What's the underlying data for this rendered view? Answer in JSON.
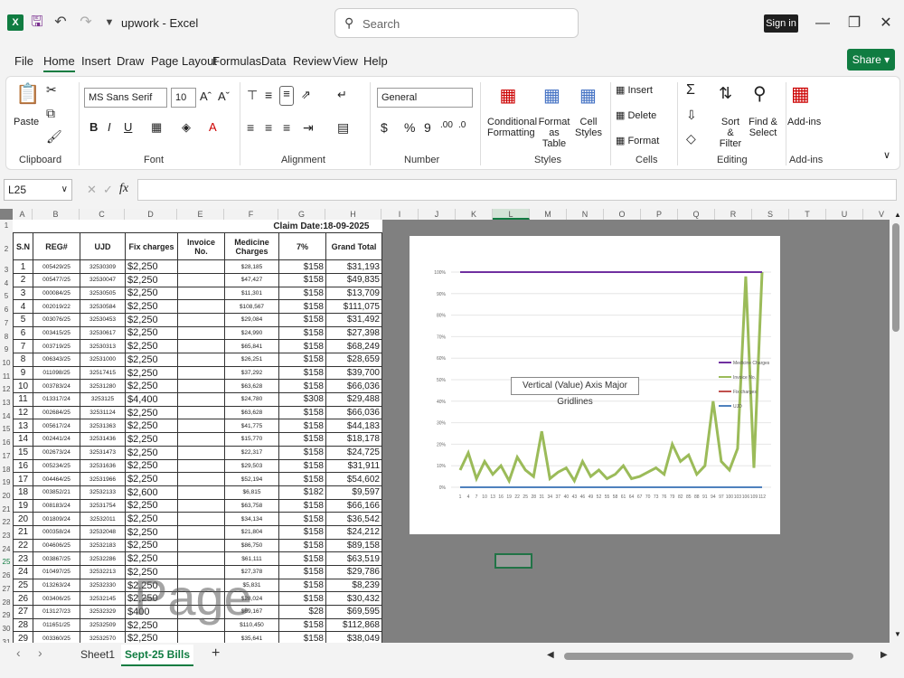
{
  "app": {
    "file_name": "upwork",
    "app_name": "Excel",
    "sign_in": "Sign in",
    "search_placeholder": "Search"
  },
  "menu": [
    "File",
    "Home",
    "Insert",
    "Draw",
    "Page Layout",
    "Formulas",
    "Data",
    "Review",
    "View",
    "Help"
  ],
  "share_label": "Share",
  "ribbon": {
    "clipboard": {
      "paste": "Paste",
      "label": "Clipboard"
    },
    "font": {
      "name": "MS Sans Serif",
      "size": "10",
      "label": "Font"
    },
    "alignment": {
      "label": "Alignment"
    },
    "number": {
      "format": "General",
      "label": "Number"
    },
    "styles": {
      "conditional": "Conditional",
      "formatting": "Formatting",
      "format_as": "Format as",
      "table": "Table",
      "cell": "Cell",
      "styles_text": "Styles",
      "label": "Styles"
    },
    "cells": {
      "insert": "Insert",
      "delete": "Delete",
      "format": "Format",
      "label": "Cells"
    },
    "editing": {
      "sort": "Sort &",
      "filter": "Filter",
      "find": "Find &",
      "select": "Select",
      "label": "Editing"
    },
    "addins": {
      "button": "Add-ins",
      "label": "Add-ins"
    }
  },
  "formula_bar": {
    "cell_ref": "L25",
    "fx": "fx"
  },
  "columns": [
    "A",
    "B",
    "C",
    "D",
    "E",
    "F",
    "G",
    "H",
    "I",
    "J",
    "K",
    "L",
    "M",
    "N",
    "O",
    "P",
    "Q",
    "R",
    "S",
    "T",
    "U",
    "V"
  ],
  "sheet": {
    "claim_date": "Claim Date:18-09-2025",
    "headers": [
      "S.N",
      "REG#",
      "UJD",
      "Fix charges",
      "Invoice No.",
      "Medicine Charges",
      "7%",
      "Grand Total"
    ],
    "rows": [
      [
        "1",
        "005429/25",
        "32530309",
        "$2,250",
        "",
        "$28,185",
        "$158",
        "$31,193"
      ],
      [
        "2",
        "005477/25",
        "32530047",
        "$2,250",
        "",
        "$47,427",
        "$158",
        "$49,835"
      ],
      [
        "3",
        "000084/25",
        "32530505",
        "$2,250",
        "",
        "$11,301",
        "$158",
        "$13,709"
      ],
      [
        "4",
        "002019/22",
        "32530584",
        "$2,250",
        "",
        "$108,567",
        "$158",
        "$111,075"
      ],
      [
        "5",
        "003076/25",
        "32530453",
        "$2,250",
        "",
        "$29,084",
        "$158",
        "$31,492"
      ],
      [
        "6",
        "003415/25",
        "32530617",
        "$2,250",
        "",
        "$24,990",
        "$158",
        "$27,398"
      ],
      [
        "7",
        "003719/25",
        "32530313",
        "$2,250",
        "",
        "$65,841",
        "$158",
        "$68,249"
      ],
      [
        "8",
        "006343/25",
        "32531000",
        "$2,250",
        "",
        "$26,251",
        "$158",
        "$28,659"
      ],
      [
        "9",
        "011098/25",
        "32517415",
        "$2,250",
        "",
        "$37,292",
        "$158",
        "$39,700"
      ],
      [
        "10",
        "003783/24",
        "32531280",
        "$2,250",
        "",
        "$63,628",
        "$158",
        "$66,036"
      ],
      [
        "11",
        "013317/24",
        "3253125",
        "$4,400",
        "",
        "$24,780",
        "$308",
        "$29,488"
      ],
      [
        "12",
        "002684/25",
        "32531124",
        "$2,250",
        "",
        "$63,628",
        "$158",
        "$66,036"
      ],
      [
        "13",
        "005617/24",
        "32531363",
        "$2,250",
        "",
        "$41,775",
        "$158",
        "$44,183"
      ],
      [
        "14",
        "002441/24",
        "32531436",
        "$2,250",
        "",
        "$15,770",
        "$158",
        "$18,178"
      ],
      [
        "15",
        "002673/24",
        "32531473",
        "$2,250",
        "",
        "$22,317",
        "$158",
        "$24,725"
      ],
      [
        "16",
        "005234/25",
        "32531636",
        "$2,250",
        "",
        "$29,503",
        "$158",
        "$31,911"
      ],
      [
        "17",
        "004464/25",
        "32531966",
        "$2,250",
        "",
        "$52,194",
        "$158",
        "$54,602"
      ],
      [
        "18",
        "003852/21",
        "32532133",
        "$2,600",
        "",
        "$6,815",
        "$182",
        "$9,597"
      ],
      [
        "19",
        "008183/24",
        "32531754",
        "$2,250",
        "",
        "$63,758",
        "$158",
        "$66,166"
      ],
      [
        "20",
        "001809/24",
        "32532011",
        "$2,250",
        "",
        "$34,134",
        "$158",
        "$36,542"
      ],
      [
        "21",
        "000358/24",
        "32532048",
        "$2,250",
        "",
        "$21,804",
        "$158",
        "$24,212"
      ],
      [
        "22",
        "004606/25",
        "32532183",
        "$2,250",
        "",
        "$86,750",
        "$158",
        "$89,158"
      ],
      [
        "23",
        "003867/25",
        "32532286",
        "$2,250",
        "",
        "$61,111",
        "$158",
        "$63,519"
      ],
      [
        "24",
        "010497/25",
        "32532213",
        "$2,250",
        "",
        "$27,378",
        "$158",
        "$29,786"
      ],
      [
        "25",
        "013263/24",
        "32532330",
        "$2,250",
        "",
        "$5,831",
        "$158",
        "$8,239"
      ],
      [
        "26",
        "003406/25",
        "32532145",
        "$2,250",
        "",
        "$28,024",
        "$158",
        "$30,432"
      ],
      [
        "27",
        "013127/23",
        "32532329",
        "$400",
        "",
        "$69,167",
        "$28",
        "$69,595"
      ],
      [
        "28",
        "011651/25",
        "32532509",
        "$2,250",
        "",
        "$110,450",
        "$158",
        "$112,868"
      ],
      [
        "29",
        "003360/25",
        "32532570",
        "$2,250",
        "",
        "$35,641",
        "$158",
        "$38,049"
      ]
    ]
  },
  "chart_data": {
    "type": "line",
    "title": "",
    "ylim": [
      0,
      100
    ],
    "y_ticks": [
      "0%",
      "10%",
      "20%",
      "30%",
      "40%",
      "50%",
      "60%",
      "70%",
      "80%",
      "90%",
      "100%"
    ],
    "x": [
      "1",
      "4",
      "7",
      "10",
      "13",
      "16",
      "19",
      "22",
      "25",
      "28",
      "31",
      "34",
      "37",
      "40",
      "43",
      "46",
      "49",
      "52",
      "55",
      "58",
      "61",
      "64",
      "67",
      "70",
      "73",
      "76",
      "79",
      "82",
      "85",
      "88",
      "91",
      "94",
      "97",
      "100",
      "103",
      "106",
      "109",
      "112"
    ],
    "series": [
      {
        "name": "Medicine Charges",
        "color": "#7030a0",
        "values": [
          100,
          100,
          100,
          100,
          100,
          100,
          100,
          100,
          100,
          100,
          100,
          100,
          100,
          100,
          100,
          100,
          100,
          100,
          100,
          100,
          100,
          100,
          100,
          100,
          100,
          100,
          100,
          100,
          100,
          100,
          100,
          100,
          100,
          100,
          100,
          100,
          100,
          100
        ]
      },
      {
        "name": "Invoice No.",
        "color": "#9bbb59",
        "values": [
          8,
          16,
          4,
          12,
          6,
          10,
          3,
          14,
          8,
          5,
          26,
          4,
          7,
          9,
          3,
          12,
          5,
          8,
          4,
          6,
          10,
          4,
          5,
          7,
          9,
          6,
          20,
          12,
          15,
          6,
          10,
          40,
          12,
          8,
          18,
          98,
          9,
          100
        ]
      },
      {
        "name": "Fix charges",
        "color": "#c0504d",
        "values": [
          0,
          0,
          0,
          0,
          0,
          0,
          0,
          0,
          0,
          0,
          0,
          0,
          0,
          0,
          0,
          0,
          0,
          0,
          0,
          0,
          0,
          0,
          0,
          0,
          0,
          0,
          0,
          0,
          0,
          0,
          0,
          0,
          0,
          0,
          0,
          0,
          0,
          0
        ]
      },
      {
        "name": "UJD",
        "color": "#4f81bd",
        "values": [
          0,
          0,
          0,
          0,
          0,
          0,
          0,
          0,
          0,
          0,
          0,
          0,
          0,
          0,
          0,
          0,
          0,
          0,
          0,
          0,
          0,
          0,
          0,
          0,
          0,
          0,
          0,
          0,
          0,
          0,
          0,
          0,
          0,
          0,
          0,
          0,
          0,
          0
        ]
      }
    ],
    "legend_position": "right"
  },
  "tooltip": "Vertical (Value) Axis Major Gridlines",
  "watermark": "Page",
  "sheet_tabs": [
    "Sheet1",
    "Sept-25 Bills"
  ]
}
